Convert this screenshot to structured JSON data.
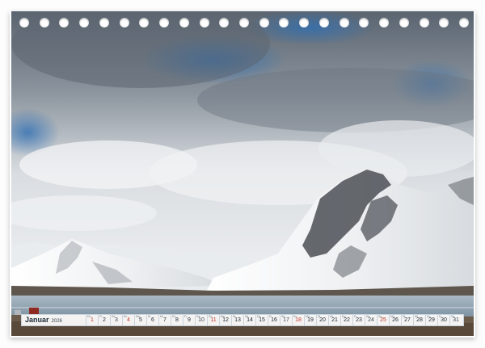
{
  "calendar": {
    "month": "Januar",
    "year": "2026",
    "days": [
      {
        "n": "1",
        "wd": "Do",
        "type": "hol"
      },
      {
        "n": "2",
        "wd": "Fr",
        "type": ""
      },
      {
        "n": "3",
        "wd": "Sa",
        "type": "sat"
      },
      {
        "n": "4",
        "wd": "So",
        "type": "sun"
      },
      {
        "n": "5",
        "wd": "Mo",
        "type": ""
      },
      {
        "n": "6",
        "wd": "Di",
        "type": ""
      },
      {
        "n": "7",
        "wd": "Mi",
        "type": ""
      },
      {
        "n": "8",
        "wd": "Do",
        "type": ""
      },
      {
        "n": "9",
        "wd": "Fr",
        "type": ""
      },
      {
        "n": "10",
        "wd": "Sa",
        "type": "sat"
      },
      {
        "n": "11",
        "wd": "So",
        "type": "sun"
      },
      {
        "n": "12",
        "wd": "Mo",
        "type": ""
      },
      {
        "n": "13",
        "wd": "Di",
        "type": ""
      },
      {
        "n": "14",
        "wd": "Mi",
        "type": ""
      },
      {
        "n": "15",
        "wd": "Do",
        "type": ""
      },
      {
        "n": "16",
        "wd": "Fr",
        "type": ""
      },
      {
        "n": "17",
        "wd": "Sa",
        "type": "sat"
      },
      {
        "n": "18",
        "wd": "So",
        "type": "sun"
      },
      {
        "n": "19",
        "wd": "Mo",
        "type": ""
      },
      {
        "n": "20",
        "wd": "Di",
        "type": ""
      },
      {
        "n": "21",
        "wd": "Mi",
        "type": ""
      },
      {
        "n": "22",
        "wd": "Do",
        "type": ""
      },
      {
        "n": "23",
        "wd": "Fr",
        "type": ""
      },
      {
        "n": "24",
        "wd": "Sa",
        "type": "sat"
      },
      {
        "n": "25",
        "wd": "So",
        "type": "sun"
      },
      {
        "n": "26",
        "wd": "Mo",
        "type": ""
      },
      {
        "n": "27",
        "wd": "Di",
        "type": ""
      },
      {
        "n": "28",
        "wd": "Mi",
        "type": ""
      },
      {
        "n": "29",
        "wd": "Do",
        "type": ""
      },
      {
        "n": "30",
        "wd": "Fr",
        "type": ""
      },
      {
        "n": "31",
        "wd": "Sa",
        "type": "sat"
      }
    ]
  },
  "binding": {
    "hole_count": 23
  },
  "colors": {
    "sky_blue": "#3f7fbf",
    "cloud": "#e8ebee",
    "snow": "#f2f4f6",
    "rock": "#4a4d52",
    "water": "#8fa7b8"
  }
}
